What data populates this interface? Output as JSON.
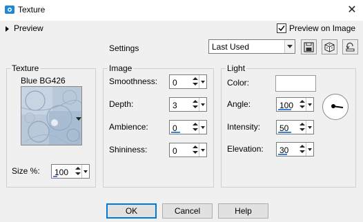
{
  "window": {
    "title": "Texture"
  },
  "preview": {
    "label": "Preview"
  },
  "preview_on_image": {
    "label": "Preview on Image",
    "checked": true
  },
  "settings": {
    "label": "Settings",
    "preset": "Last Used"
  },
  "texture": {
    "group_label": "Texture",
    "name": "Blue BG426",
    "size_label": "Size %:",
    "size_value": "100",
    "size_fill": 0.2
  },
  "image": {
    "group_label": "Image",
    "fields": [
      {
        "label": "Smoothness:",
        "value": "0",
        "fill": 0.0
      },
      {
        "label": "Depth:",
        "value": "3",
        "fill": 0.0
      },
      {
        "label": "Ambience:",
        "value": "0",
        "fill": 0.4
      },
      {
        "label": "Shininess:",
        "value": "0",
        "fill": 0.0
      }
    ]
  },
  "light": {
    "group_label": "Light",
    "color_label": "Color:",
    "color_value": "#ffffff",
    "angle_label": "Angle:",
    "angle_value": "100",
    "angle_fill": 0.6,
    "intensity_label": "Intensity:",
    "intensity_value": "50",
    "intensity_fill": 0.6,
    "elevation_label": "Elevation:",
    "elevation_value": "30",
    "elevation_fill": 0.4
  },
  "buttons": {
    "ok": "OK",
    "cancel": "Cancel",
    "help": "Help"
  },
  "colors": {
    "accent": "#3b7ce0",
    "focus_border": "#0078d7",
    "app_icon": "#1e88d6"
  },
  "icons": {
    "app": "texture-app-icon",
    "expand": "triangle-right-icon",
    "save_preset": "save-icon",
    "manage_presets": "dice-icon",
    "reset": "reset-icon",
    "close": "close-icon"
  }
}
